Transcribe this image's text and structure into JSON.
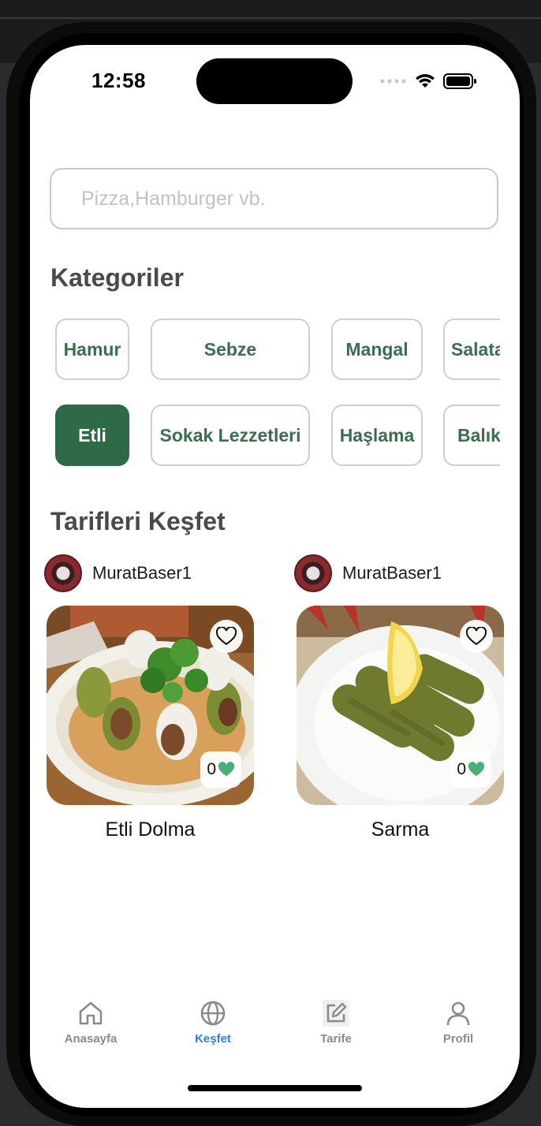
{
  "status_bar": {
    "time": "12:58",
    "icons": [
      "signal-dots-icon",
      "wifi-icon",
      "battery-icon"
    ]
  },
  "search": {
    "placeholder": "Pizza,Hamburger vb."
  },
  "categories": {
    "heading": "Kategoriler",
    "items": [
      {
        "label": "Hamur",
        "active": false
      },
      {
        "label": "Sebze",
        "active": false
      },
      {
        "label": "Mangal",
        "active": false
      },
      {
        "label": "Salata",
        "active": false
      },
      {
        "label": "Etli",
        "active": true
      },
      {
        "label": "Sokak Lezzetleri",
        "active": false
      },
      {
        "label": "Haşlama",
        "active": false
      },
      {
        "label": "Balık",
        "active": false
      }
    ]
  },
  "discover": {
    "heading": "Tarifleri Keşfet",
    "recipes": [
      {
        "user": "MuratBaser1",
        "title": "Etli Dolma",
        "likes": "0"
      },
      {
        "user": "MuratBaser1",
        "title": "Sarma",
        "likes": "0"
      }
    ]
  },
  "tabbar": {
    "items": [
      {
        "label": "Anasayfa",
        "icon": "home-icon",
        "active": false
      },
      {
        "label": "Keşfet",
        "icon": "globe-icon",
        "active": true
      },
      {
        "label": "Tarife",
        "icon": "edit-icon",
        "active": false
      },
      {
        "label": "Profil",
        "icon": "user-icon",
        "active": false
      }
    ]
  },
  "colors": {
    "accent_green": "#2e6a45",
    "chip_text": "#3b6e4e",
    "active_tab": "#2f7fd6",
    "like_heart": "#4caf78"
  }
}
